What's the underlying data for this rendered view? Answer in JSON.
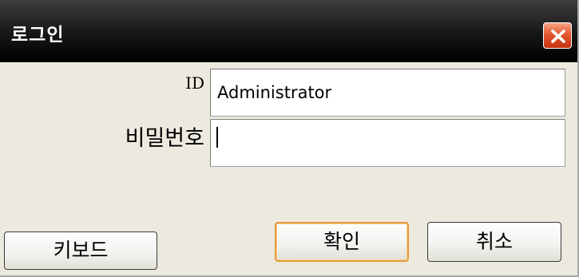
{
  "window": {
    "title": "로그인",
    "close_icon": "close-icon"
  },
  "form": {
    "id_label": "ID",
    "id_value": "Administrator",
    "password_label": "비밀번호",
    "password_value": ""
  },
  "buttons": {
    "keyboard": "키보드",
    "ok": "확인",
    "cancel": "취소"
  },
  "colors": {
    "titlebar": "#1a1a1a",
    "close_button": "#e4572f",
    "focus_border": "#e49b3a",
    "dialog_background": "#ece9df"
  }
}
